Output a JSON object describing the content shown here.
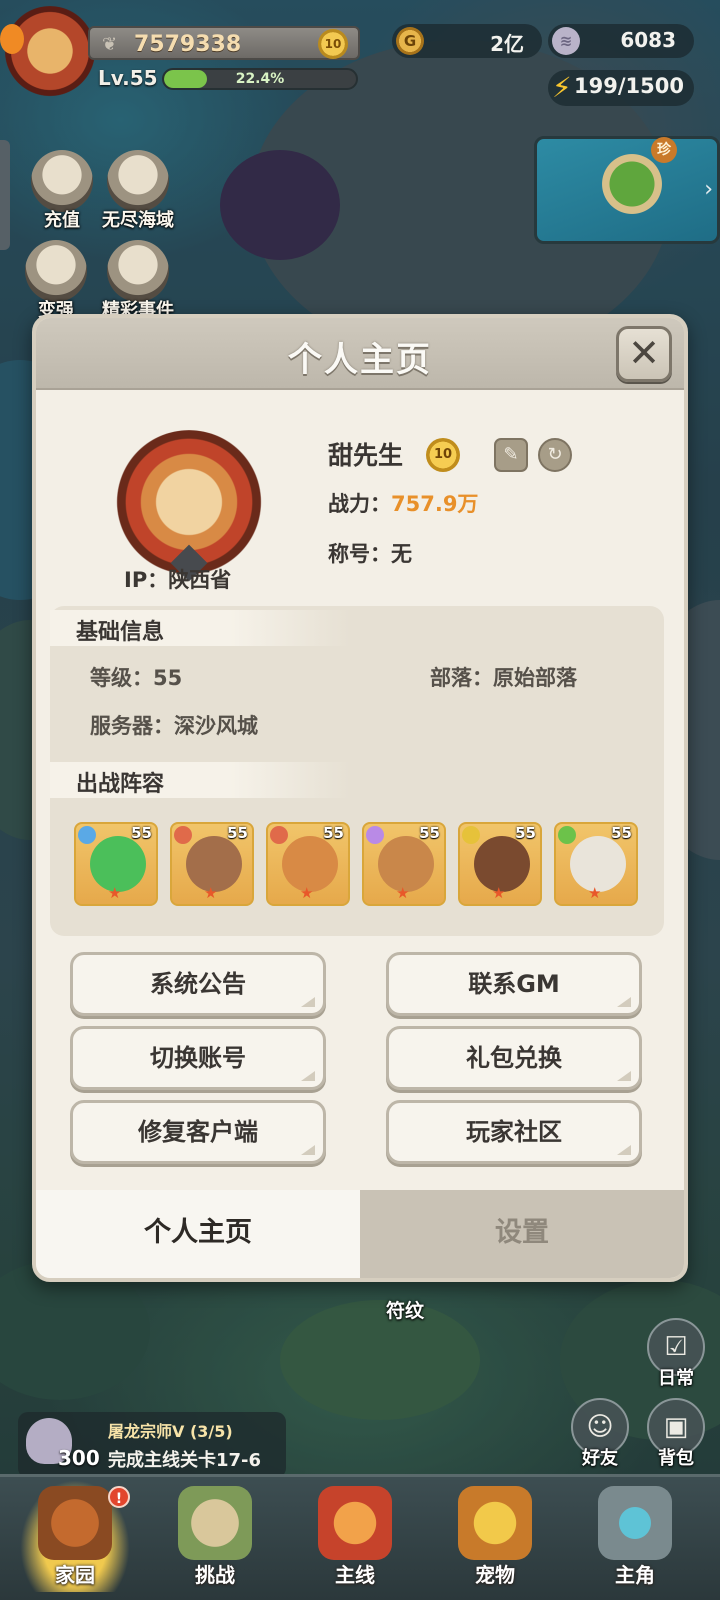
{
  "hud": {
    "combat_power": "7579338",
    "vip_level": "10",
    "level": "Lv.55",
    "exp_percent_label": "22.4%",
    "exp_fraction": 0.224,
    "gold": "2亿",
    "shells": "6083",
    "energy": "199/1500",
    "minimap_tag": "珍"
  },
  "side_menu": [
    {
      "label": "充值",
      "icon": "shell-icon"
    },
    {
      "label": "无尽海域",
      "icon": "ship-map-icon"
    },
    {
      "label": "变强",
      "icon": "fist-icon"
    },
    {
      "label": "精彩事件",
      "icon": "paw-icon"
    }
  ],
  "modal": {
    "title": "个人主页",
    "close_icon": "close-icon",
    "profile": {
      "name": "甜先生",
      "vip": "10",
      "power_label": "战力：",
      "power_value": "757.9万",
      "title_label": "称号：",
      "title_value": "无",
      "ip": "IP：陕西省"
    },
    "basic_info": {
      "heading": "基础信息",
      "level": "等级：55",
      "tribe": "部落：原始部落",
      "server": "服务器：深沙风城"
    },
    "lineup": {
      "heading": "出战阵容",
      "heroes": [
        {
          "level": "55",
          "element": "#5aa9e6",
          "face": "#4bbf5a"
        },
        {
          "level": "55",
          "element": "#e06a4a",
          "face": "#a36e4a"
        },
        {
          "level": "55",
          "element": "#e06a4a",
          "face": "#d88a45"
        },
        {
          "level": "55",
          "element": "#b98ae6",
          "face": "#c9874a"
        },
        {
          "level": "55",
          "element": "#e6c23a",
          "face": "#7a4a2f"
        },
        {
          "level": "55",
          "element": "#6cc24a",
          "face": "#e9e4da"
        }
      ]
    },
    "buttons": {
      "announcement": "系统公告",
      "contact_gm": "联系GM",
      "switch_account": "切换账号",
      "gift_code": "礼包兑换",
      "repair_client": "修复客户端",
      "community": "玩家社区"
    },
    "tabs": {
      "profile": "个人主页",
      "settings": "设置"
    }
  },
  "quest": {
    "reward_count": "300",
    "title": "屠龙宗师V (3/5)",
    "task": "完成主线关卡17-6"
  },
  "right_buttons": {
    "daily": "日常",
    "friends": "好友",
    "backpack": "背包",
    "rune": "符纹"
  },
  "bottom_nav": {
    "badge": "!",
    "items": [
      "家园",
      "挑战",
      "主线",
      "宠物",
      "主角"
    ]
  }
}
